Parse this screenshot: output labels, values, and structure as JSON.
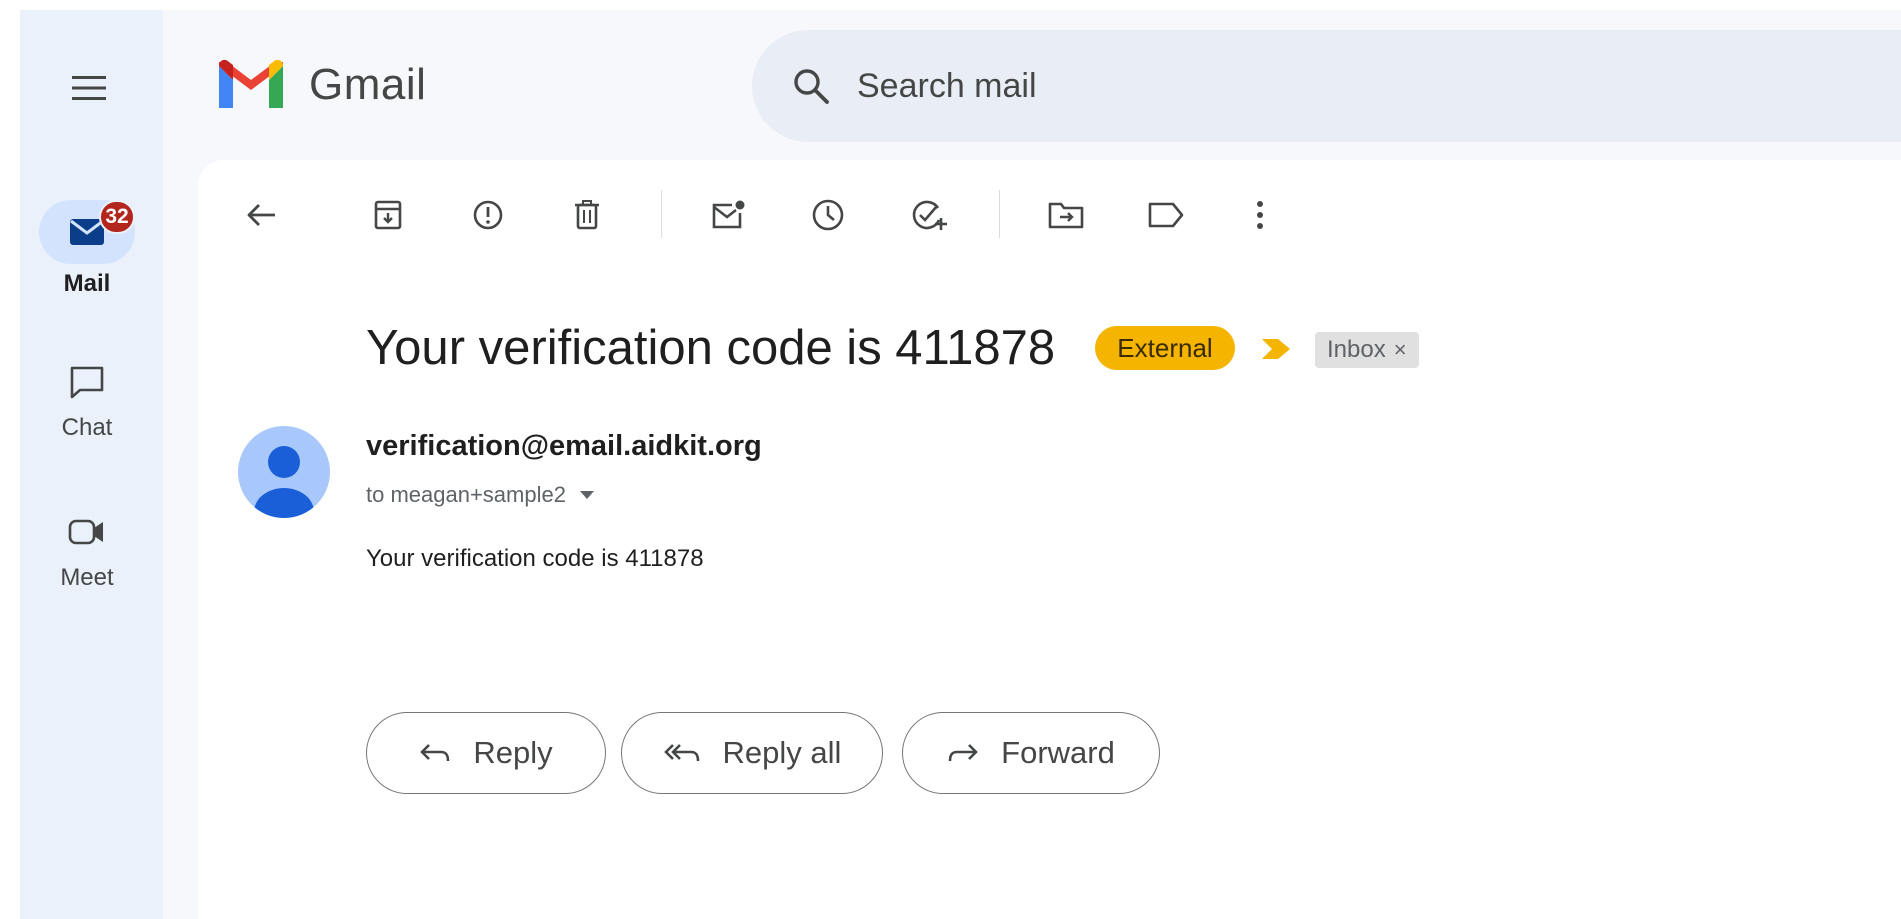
{
  "app": {
    "name": "Gmail",
    "brand_colors": {
      "red": "#ea4335",
      "blue": "#4285f4",
      "green": "#34a853",
      "yellow": "#fbbc04"
    }
  },
  "search": {
    "placeholder": "Search mail",
    "value": ""
  },
  "rail": {
    "menu_icon": "hamburger-menu-icon",
    "items": [
      {
        "label": "Mail",
        "icon": "mail-icon",
        "badge": "32",
        "active": true
      },
      {
        "label": "Chat",
        "icon": "chat-icon",
        "active": false
      },
      {
        "label": "Meet",
        "icon": "video-camera-icon",
        "active": false
      }
    ]
  },
  "toolbar": {
    "icons": [
      "back-arrow-icon",
      "archive-icon",
      "report-spam-icon",
      "delete-icon",
      "mark-unread-icon",
      "snooze-icon",
      "add-to-tasks-icon",
      "move-to-icon",
      "label-icon",
      "more-options-icon"
    ]
  },
  "email": {
    "subject": "Your verification code is 411878",
    "labels": {
      "external": "External",
      "inbox": "Inbox",
      "inbox_remove": "×"
    },
    "sender": "verification@email.aidkit.org",
    "recipient": "to meagan+sample2",
    "body": "Your verification code is 411878",
    "colors": {
      "external_chip": "#f4b400",
      "importance_marker": "#f4b400"
    }
  },
  "actions": {
    "reply": "Reply",
    "reply_all": "Reply all",
    "forward": "Forward"
  }
}
